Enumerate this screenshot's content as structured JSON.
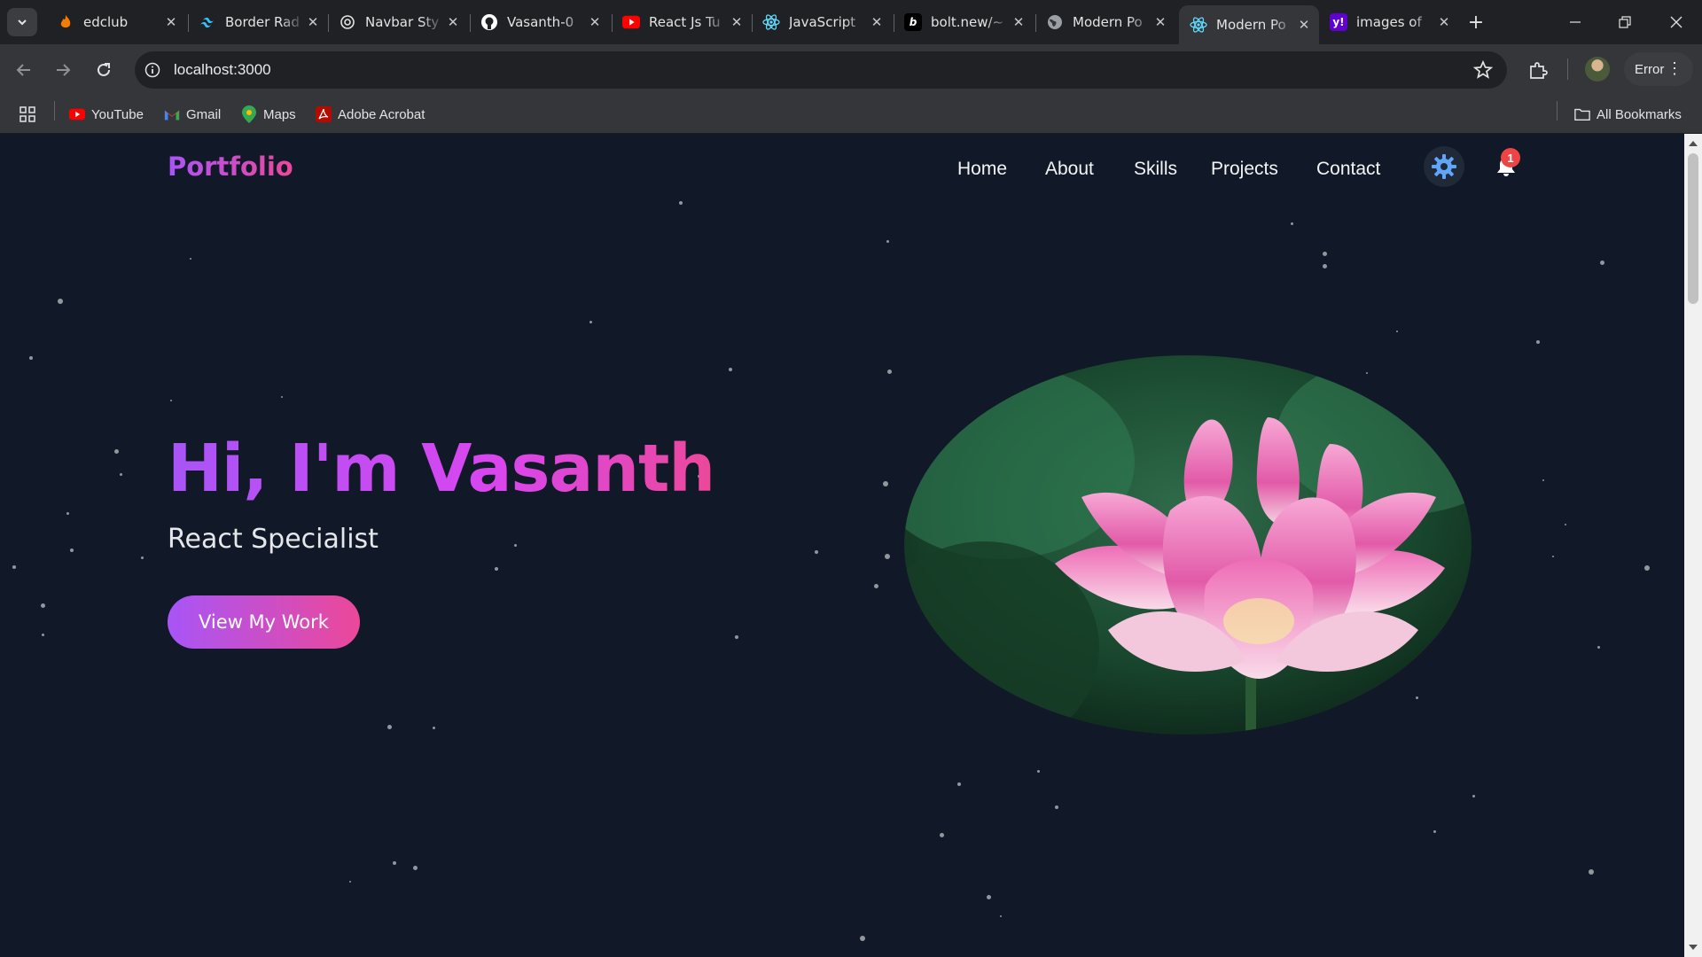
{
  "browser": {
    "tabs": [
      {
        "title": "edclub",
        "icon": "fire-icon",
        "color": "#f57c00"
      },
      {
        "title": "Border Rad",
        "icon": "tailwind-icon",
        "color": "#38bdf8"
      },
      {
        "title": "Navbar Sty",
        "icon": "openai-icon",
        "color": "#e3e3e3"
      },
      {
        "title": "Vasanth-0",
        "icon": "github-icon",
        "color": "#ffffff"
      },
      {
        "title": "React Js Tu",
        "icon": "youtube-icon",
        "color": "#ff0000"
      },
      {
        "title": "JavaScript",
        "icon": "react-icon",
        "color": "#61dafb"
      },
      {
        "title": "bolt.new/~",
        "icon": "bolt-icon",
        "color": "#000000"
      },
      {
        "title": "Modern Po",
        "icon": "globe-icon",
        "color": "#9aa0a6"
      },
      {
        "title": "Modern Po",
        "icon": "react-icon",
        "color": "#61dafb",
        "active": true
      },
      {
        "title": "images of",
        "icon": "yahoo-icon",
        "color": "#6001d2"
      }
    ],
    "url": "localhost:3000",
    "profile_status": "Error",
    "bookmarks": [
      {
        "label": "YouTube",
        "icon": "youtube-icon"
      },
      {
        "label": "Gmail",
        "icon": "gmail-icon"
      },
      {
        "label": "Maps",
        "icon": "maps-icon"
      },
      {
        "label": "Adobe Acrobat",
        "icon": "acrobat-icon"
      }
    ],
    "all_bookmarks": "All Bookmarks"
  },
  "site": {
    "logo": "Portfolio",
    "nav": [
      "Home",
      "About",
      "Skills",
      "Projects",
      "Contact"
    ],
    "notification_count": "1",
    "theme_icon": "sun-gear-icon",
    "hero": {
      "title": "Hi, I'm Vasanth",
      "subtitle": "React Specialist",
      "cta": "View My Work",
      "image": "pink-lotus-flower"
    },
    "colors": {
      "background": "#111827",
      "gradient_start": "#a855f7",
      "gradient_end": "#ec4899",
      "badge": "#ef4444",
      "accent_icon": "#60a5fa"
    }
  }
}
